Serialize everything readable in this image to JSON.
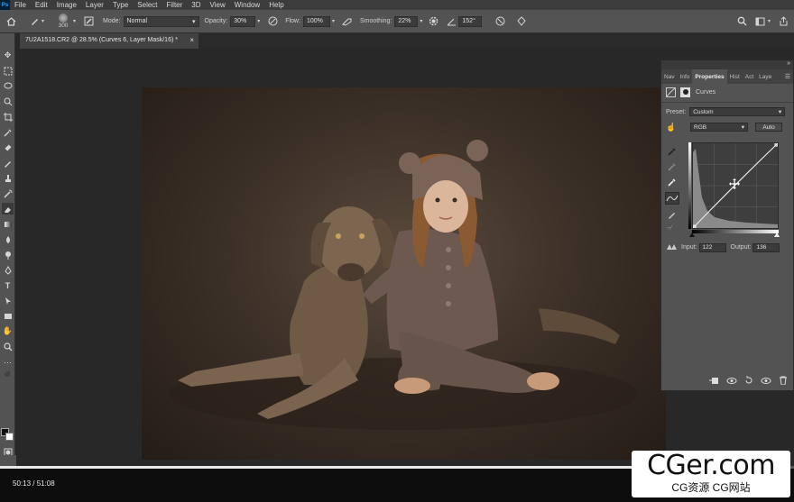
{
  "menubar": {
    "logo": "Ps",
    "items": [
      "File",
      "Edit",
      "Image",
      "Layer",
      "Type",
      "Select",
      "Filter",
      "3D",
      "View",
      "Window",
      "Help"
    ]
  },
  "options": {
    "brush_size": "300",
    "mode_label": "Mode:",
    "mode_value": "Normal",
    "opacity_label": "Opacity:",
    "opacity_value": "30%",
    "flow_label": "Flow:",
    "flow_value": "100%",
    "smoothing_label": "Smoothing:",
    "smoothing_value": "22%",
    "angle_value": "152°"
  },
  "document": {
    "tab_title": "7U2A1518.CR2 @ 28.5% (Curves 6, Layer Mask/16) *"
  },
  "panel": {
    "tabs": [
      "Nav",
      "Info",
      "Properties",
      "Hist",
      "Act",
      "Laye"
    ],
    "header_label": "Curves",
    "preset_label": "Preset:",
    "preset_value": "Custom",
    "channel_value": "RGB",
    "auto_label": "Auto",
    "input_label": "Input:",
    "input_value": "122",
    "output_label": "Output:",
    "output_value": "136"
  },
  "video": {
    "timecode": "50:13 / 51:08",
    "progress": 0.982
  },
  "watermark": {
    "title": "CGer.com",
    "subtitle": "CG资源 CG网站"
  },
  "colors": {
    "panel_bg": "#535353",
    "app_bg": "#282828",
    "accent": "#31a8ff"
  }
}
